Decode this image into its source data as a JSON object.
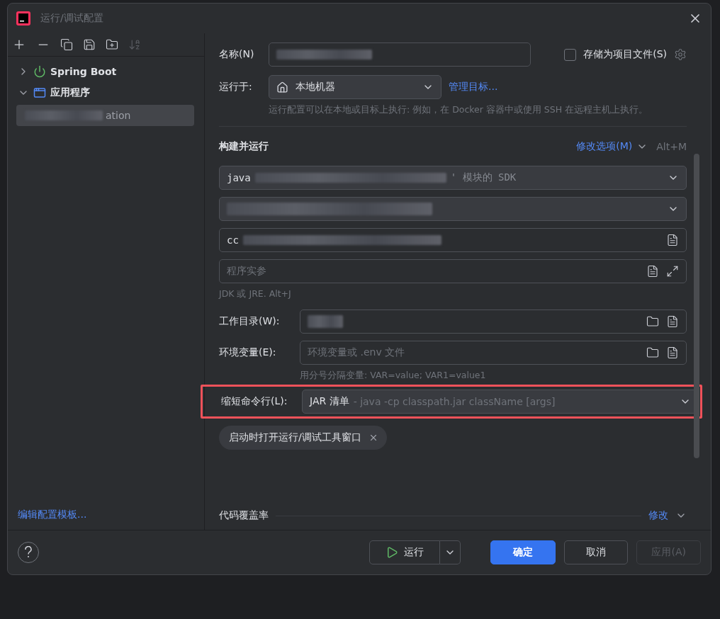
{
  "window": {
    "title": "运行/调试配置"
  },
  "tree": [
    {
      "label": "Spring Boot",
      "kind": "spring",
      "expanded": false
    },
    {
      "label": "应用程序",
      "kind": "app",
      "expanded": true,
      "children": [
        {
          "label": "ation",
          "selected": true
        }
      ]
    }
  ],
  "edit_templates_link": "编辑配置模板...",
  "name_field": {
    "label": "名称(N)"
  },
  "store_as_file": {
    "label": "存储为项目文件(S)",
    "checked": false
  },
  "run_on": {
    "label": "运行于:",
    "value": "本地机器",
    "link": "管理目标...",
    "hint": "运行配置可以在本地或目标上执行: 例如，在 Docker 容器中或使用 SSH 在远程主机上执行。"
  },
  "section": {
    "title": "构建并运行",
    "modify_link": "修改选项(M)",
    "shortcut": "Alt+M"
  },
  "sdk": {
    "value": "java",
    "suffix": "' 模块的 SDK"
  },
  "main_class": {
    "value": "cc"
  },
  "program_args": {
    "placeholder": "程序实参"
  },
  "jdk_hint": "JDK 或 JRE. Alt+J",
  "working_dir": {
    "label": "工作目录(W):"
  },
  "env": {
    "label": "环境变量(E):",
    "placeholder": "环境变量或 .env 文件",
    "hint": "用分号分隔变量: VAR=value; VAR1=value1"
  },
  "shorten": {
    "label": "缩短命令行(L):",
    "value": "JAR 清单",
    "detail": "- java -cp classpath.jar className [args]",
    "highlighted": true
  },
  "chips": [
    {
      "label": "启动时打开运行/调试工具窗口"
    }
  ],
  "coverage": {
    "title": "代码覆盖率",
    "link": "修改"
  },
  "buttons": [
    {
      "label": "运行",
      "kind": "run",
      "disabled": false
    },
    {
      "label": "确定",
      "kind": "primary",
      "disabled": false
    },
    {
      "label": "取消",
      "kind": "default",
      "disabled": false
    },
    {
      "label": "应用(A)",
      "kind": "default",
      "disabled": true
    }
  ]
}
